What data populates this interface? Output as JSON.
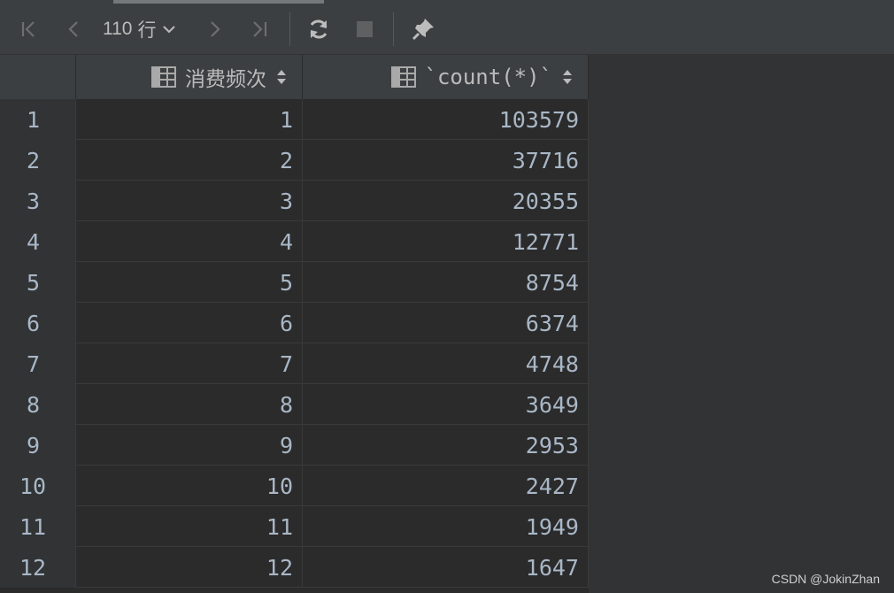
{
  "toolbar": {
    "row_count": "110",
    "row_unit": "行",
    "icons": [
      "first-page-icon",
      "prev-page-icon",
      "next-page-icon",
      "last-page-icon",
      "refresh-icon",
      "stop-icon",
      "pin-icon"
    ]
  },
  "table": {
    "columns": [
      {
        "label": "消费频次",
        "icon": "table-column-icon",
        "sort_icon": "sort-arrows-icon"
      },
      {
        "label": "`count(*)`",
        "icon": "table-column-icon",
        "sort_icon": "sort-arrows-icon"
      }
    ],
    "rows": [
      {
        "num": "1",
        "freq": "1",
        "count": "103579"
      },
      {
        "num": "2",
        "freq": "2",
        "count": "37716"
      },
      {
        "num": "3",
        "freq": "3",
        "count": "20355"
      },
      {
        "num": "4",
        "freq": "4",
        "count": "12771"
      },
      {
        "num": "5",
        "freq": "5",
        "count": "8754"
      },
      {
        "num": "6",
        "freq": "6",
        "count": "6374"
      },
      {
        "num": "7",
        "freq": "7",
        "count": "4748"
      },
      {
        "num": "8",
        "freq": "8",
        "count": "3649"
      },
      {
        "num": "9",
        "freq": "9",
        "count": "2953"
      },
      {
        "num": "10",
        "freq": "10",
        "count": "2427"
      },
      {
        "num": "11",
        "freq": "11",
        "count": "1949"
      },
      {
        "num": "12",
        "freq": "12",
        "count": "1647"
      }
    ]
  },
  "watermark": "CSDN @JokinZhan",
  "colors": {
    "toolbar_bg": "#3c3f41",
    "grid_bg": "#2b2b2b",
    "text": "#a9b7c6",
    "row_marker": "#2d5d7b"
  }
}
